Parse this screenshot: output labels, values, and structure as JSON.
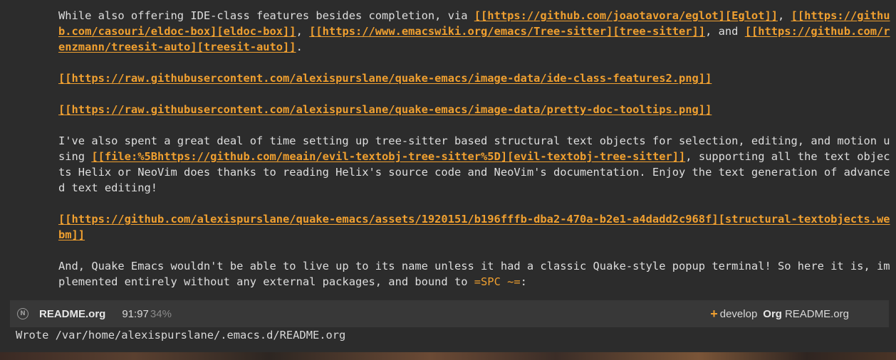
{
  "buffer": {
    "p1": {
      "t1": "While also offering IDE-class features besides completion, via ",
      "l1": "[[https://github.com/joaotavora/eglot][Eglot]]",
      "t2": ", ",
      "l2": "[[https://github.com/casouri/eldoc-box][eldoc-box]]",
      "t3": ", ",
      "l3": "[[https://www.emacswiki.org/emacs/Tree-sitter][tree-sitter]]",
      "t4": ", and ",
      "l4": "[[https://github.com/renzmann/treesit-auto][treesit-auto]]",
      "t5": "."
    },
    "img1": "[[https://raw.githubusercontent.com/alexispurslane/quake-emacs/image-data/ide-class-features2.png]]",
    "img2": "[[https://raw.githubusercontent.com/alexispurslane/quake-emacs/image-data/pretty-doc-tooltips.png]]",
    "p2": {
      "t1": "I've also spent a great deal of time setting up tree-sitter based structural text objects for selection, editing, and motion using ",
      "l1": "[[file:%5Bhttps://github.com/meain/evil-textobj-tree-sitter%5D][evil-textobj-tree-sitter]]",
      "t2": ", supporting all the text objects Helix or NeoVim does thanks to reading Helix's source code and NeoVim's documentation. Enjoy the text generation of advanced text editing!"
    },
    "video": "[[https://github.com/alexispurslane/quake-emacs/assets/1920151/b196fffb-dba2-470a-b2e1-a4dadd2c968f][structural-textobjects.webm]]",
    "p3": {
      "t1": "And, Quake Emacs wouldn't be able to live up to its name unless it had a classic Quake-style popup terminal! So here it is, implemented entirely without any external packages, and bound to ",
      "code": "=SPC ~=",
      "t2": ":"
    }
  },
  "modeline": {
    "icon": "Ⓝ",
    "buffer_name": "README.org",
    "position": "91:97",
    "percent": "34%",
    "vc_icon": "+",
    "branch": "develop",
    "mode": "Org",
    "file": "README.org"
  },
  "echo_area": {
    "message": "Wrote /var/home/alexispurslane/.emacs.d/README.org"
  },
  "colors": {
    "background": "#2c2c2c",
    "text": "#dedede",
    "link": "#f0a030",
    "modeline_bg": "#383838"
  }
}
